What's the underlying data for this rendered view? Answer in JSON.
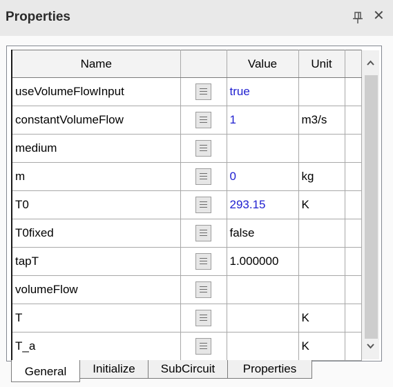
{
  "panel": {
    "title": "Properties"
  },
  "columns": {
    "name": "Name",
    "value": "Value",
    "unit": "Unit"
  },
  "rows": [
    {
      "name": "useVolumeFlowInput",
      "value": "true",
      "unit": ""
    },
    {
      "name": "constantVolumeFlow",
      "value": "1",
      "unit": "m3/s"
    },
    {
      "name": "medium",
      "value": "",
      "unit": ""
    },
    {
      "name": "m",
      "value": "0",
      "unit": "kg"
    },
    {
      "name": "T0",
      "value": "293.15",
      "unit": "K"
    },
    {
      "name": "T0fixed",
      "value": "false",
      "unit": ""
    },
    {
      "name": "tapT",
      "value": "1.000000",
      "unit": ""
    },
    {
      "name": "volumeFlow",
      "value": "",
      "unit": ""
    },
    {
      "name": "T",
      "value": "",
      "unit": "K"
    },
    {
      "name": "T_a",
      "value": "",
      "unit": "K"
    }
  ],
  "tabs": [
    {
      "label": "General",
      "active": true
    },
    {
      "label": "Initialize",
      "active": false
    },
    {
      "label": "SubCircuit",
      "active": false
    },
    {
      "label": "Properties",
      "active": false
    }
  ],
  "colors": {
    "modified_value": "#2020d0",
    "panel_bg": "#fafafa",
    "titlebar_bg": "#e9e9e9"
  }
}
